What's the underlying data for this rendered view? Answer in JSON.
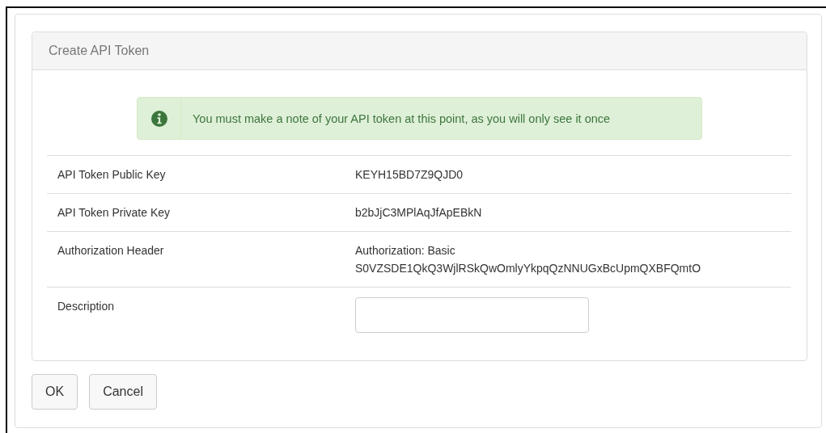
{
  "panel": {
    "title": "Create API Token"
  },
  "alert": {
    "message": "You must make a note of your API token at this point, as you will only see it once"
  },
  "fields": [
    {
      "kind": "text",
      "label": "API Token Public Key",
      "lines": [
        "KEYH15BD7Z9QJD0"
      ]
    },
    {
      "kind": "text",
      "label": "API Token Private Key",
      "lines": [
        "b2bJjC3MPlAqJfApEBkN"
      ]
    },
    {
      "kind": "text",
      "label": "Authorization Header",
      "lines": [
        "Authorization: Basic",
        "S0VZSDE1QkQ3WjlRSkQwOmlyYkpqQzNNUGxBcUpmQXBFQmtO"
      ]
    },
    {
      "kind": "input",
      "label": "Description"
    }
  ],
  "buttons": [
    "OK",
    "Cancel"
  ]
}
